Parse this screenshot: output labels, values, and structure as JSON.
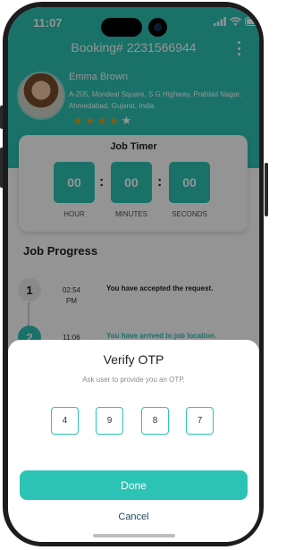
{
  "status_bar": {
    "time": "11:07"
  },
  "header": {
    "title": "Booking# 2231566944"
  },
  "customer": {
    "name": "Emma Brown",
    "address": "A-205, Mondeal Square, S G Highway, Prahlad Nagar, Ahmedabad, Gujarat, India",
    "rating": 4,
    "rating_max": 5
  },
  "job_timer": {
    "title": "Job Timer",
    "hour": "00",
    "minutes": "00",
    "seconds": "00",
    "hour_label": "HOUR",
    "minutes_label": "MINUTES",
    "seconds_label": "SECONDS"
  },
  "job_progress": {
    "title": "Job Progress",
    "steps": [
      {
        "num": "1",
        "time": "02:54",
        "ampm": "PM",
        "text": "You have accepted the request."
      },
      {
        "num": "2",
        "time": "11:06",
        "text": "You have arrived to job location."
      }
    ]
  },
  "otp_sheet": {
    "title": "Verify OTP",
    "subtitle": "Ask user to provide you an OTP.",
    "digits": [
      "4",
      "9",
      "8",
      "7"
    ],
    "done_label": "Done",
    "cancel_label": "Cancel"
  },
  "colors": {
    "accent": "#2cc3b4",
    "star": "#e3a21a",
    "cancel_text": "#1f4a60"
  }
}
